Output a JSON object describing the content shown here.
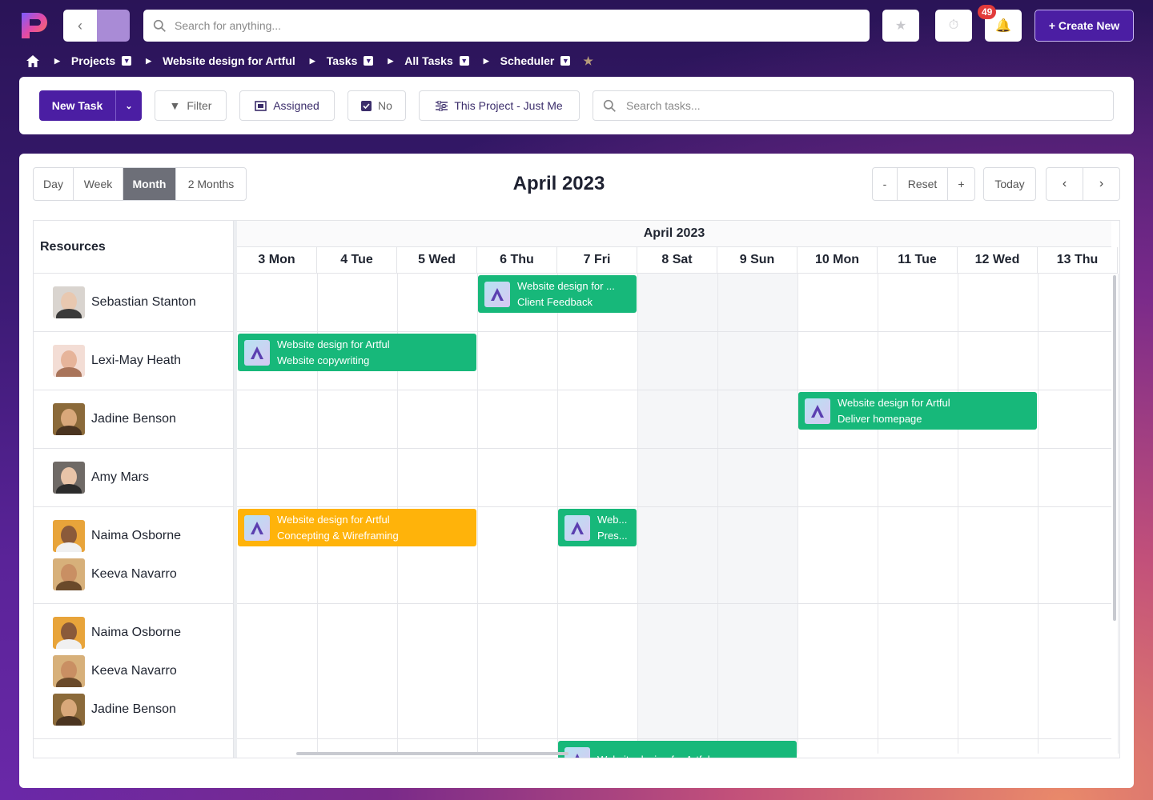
{
  "top": {
    "search_placeholder": "Search for anything...",
    "notification_count": "49",
    "create_label": "+ Create New"
  },
  "breadcrumb": {
    "items": [
      "Projects",
      "Website design for Artful",
      "Tasks",
      "All Tasks",
      "Scheduler"
    ]
  },
  "toolbar": {
    "new_task": "New Task",
    "filter": "Filter",
    "assigned": "Assigned",
    "no": "No",
    "project": "This Project - Just Me",
    "search_placeholder": "Search tasks..."
  },
  "scheduler": {
    "views": [
      "Day",
      "Week",
      "Month",
      "2 Months"
    ],
    "active_view": "Month",
    "title": "April 2023",
    "zoom_out": "-",
    "reset": "Reset",
    "zoom_in": "+",
    "today": "Today",
    "resources_header": "Resources",
    "month_header": "April 2023",
    "days": [
      "3 Mon",
      "4 Tue",
      "5 Wed",
      "6 Thu",
      "7 Fri",
      "8 Sat",
      "9 Sun",
      "10 Mon",
      "11 Tue",
      "12 Wed",
      "13 Thu"
    ],
    "rows": [
      {
        "people": [
          "Sebastian Stanton"
        ]
      },
      {
        "people": [
          "Lexi-May Heath"
        ]
      },
      {
        "people": [
          "Jadine Benson"
        ]
      },
      {
        "people": [
          "Amy Mars"
        ]
      },
      {
        "people": [
          "Naima Osborne",
          "Keeva Navarro"
        ]
      },
      {
        "people": [
          "Naima Osborne",
          "Keeva Navarro",
          "Jadine Benson"
        ]
      }
    ],
    "events": [
      {
        "line1": "Website design for ...",
        "line2": "Client Feedback",
        "color": "#17b87a"
      },
      {
        "line1": "Website design for Artful",
        "line2": "Website copywriting",
        "color": "#17b87a"
      },
      {
        "line1": "Website design for Artful",
        "line2": "Deliver homepage",
        "color": "#17b87a"
      },
      {
        "line1": "Website design for Artful",
        "line2": "Concepting & Wireframing",
        "color": "#ffb30a"
      },
      {
        "line1": "Web...",
        "line2": "Pres...",
        "color": "#17b87a"
      },
      {
        "line1": "Website design for Artful",
        "line2": "",
        "color": "#17b87a"
      }
    ]
  },
  "colors": {
    "accent": "#4b1ea3",
    "event_green": "#17b87a",
    "event_orange": "#ffb30a"
  }
}
